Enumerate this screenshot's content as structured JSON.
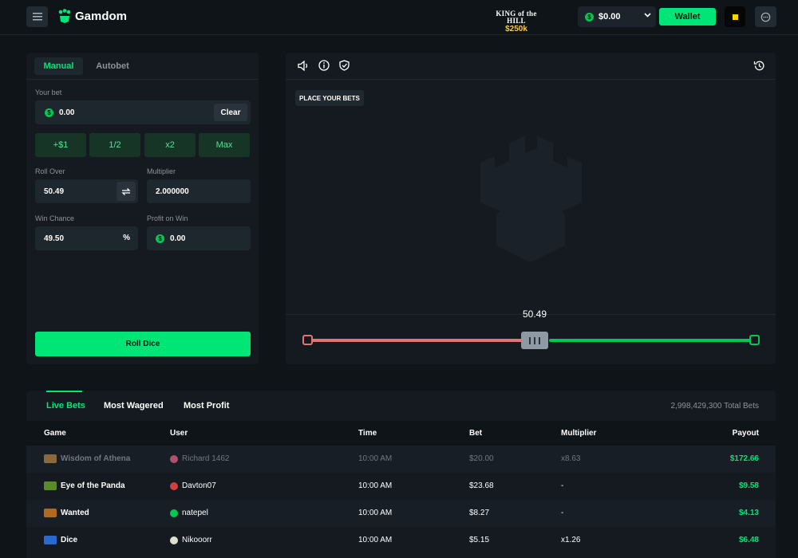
{
  "header": {
    "logo_text": "Gamdom",
    "promo_title": "KING of the HILL",
    "promo_prize": "$250k",
    "balance": "$0.00",
    "wallet_label": "Wallet"
  },
  "bet_panel": {
    "tabs": [
      "Manual",
      "Autobet"
    ],
    "your_bet_label": "Your bet",
    "bet_value": "0.00",
    "clear_label": "Clear",
    "quick_buttons": [
      "+$1",
      "1/2",
      "x2",
      "Max"
    ],
    "roll_over_label": "Roll Over",
    "roll_over_value": "50.49",
    "multiplier_label": "Multiplier",
    "multiplier_value": "2.000000",
    "win_chance_label": "Win Chance",
    "win_chance_value": "49.50",
    "win_chance_unit": "%",
    "profit_label": "Profit on Win",
    "profit_value": "0.00",
    "roll_button": "Roll Dice"
  },
  "game": {
    "place_bets": "PLACE YOUR BETS",
    "slider_value": "50.49",
    "slider_fraction": 0.5049,
    "icons": [
      "sound-icon",
      "info-icon",
      "shield-icon",
      "history-icon"
    ]
  },
  "live_bets": {
    "tabs": [
      "Live Bets",
      "Most Wagered",
      "Most Profit"
    ],
    "total": "2,998,429,300 Total Bets",
    "columns": [
      "Game",
      "User",
      "Time",
      "Bet",
      "Multiplier",
      "Payout"
    ],
    "rows": [
      {
        "game": "Wisdom of Athena",
        "user": "Richard 1462",
        "time": "10:00 AM",
        "bet": "$20.00",
        "multiplier": "x8.63",
        "payout": "$172.66",
        "dim": true
      },
      {
        "game": "Eye of the Panda",
        "user": "Davton07",
        "time": "10:00 AM",
        "bet": "$23.68",
        "multiplier": "-",
        "payout": "$9.58",
        "dim": false
      },
      {
        "game": "Wanted",
        "user": "natepel",
        "time": "10:00 AM",
        "bet": "$8.27",
        "multiplier": "-",
        "payout": "$4.13",
        "dim": false
      },
      {
        "game": "Dice",
        "user": "Nikooorr",
        "time": "10:00 AM",
        "bet": "$5.15",
        "multiplier": "x1.26",
        "payout": "$6.48",
        "dim": false
      }
    ]
  },
  "colors": {
    "accent": "#00e676",
    "background": "#0f1419",
    "panel": "#141a20",
    "lose": "#e57373"
  }
}
